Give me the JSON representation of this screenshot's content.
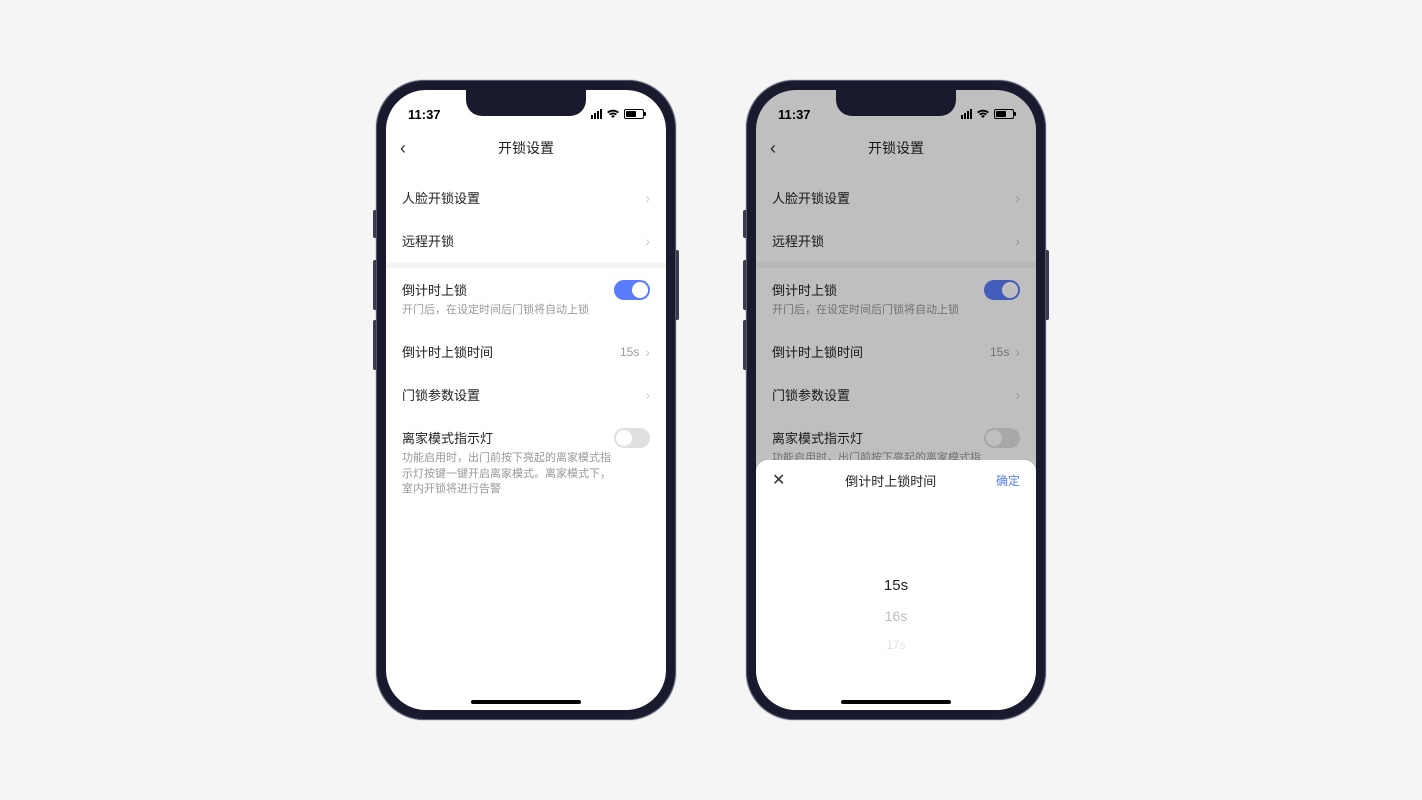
{
  "statusbar": {
    "time": "11:37"
  },
  "navbar": {
    "title": "开锁设置"
  },
  "rows": {
    "face": {
      "label": "人脸开锁设置"
    },
    "remote": {
      "label": "远程开锁"
    },
    "countdown_lock": {
      "label": "倒计时上锁",
      "sub": "开门后，在设定时间后门锁将自动上锁"
    },
    "countdown_time": {
      "label": "倒计时上锁时间",
      "value": "15s"
    },
    "lock_params": {
      "label": "门锁参数设置"
    },
    "away_mode": {
      "label": "离家模式指示灯",
      "sub": "功能启用时，出门前按下亮起的离家模式指示灯按键一键开启离家模式。离家模式下，室内开锁将进行告警"
    }
  },
  "sheet": {
    "title": "倒计时上锁时间",
    "confirm": "确定",
    "options": {
      "selected": "15s",
      "next1": "16s",
      "next2": "17s"
    }
  }
}
